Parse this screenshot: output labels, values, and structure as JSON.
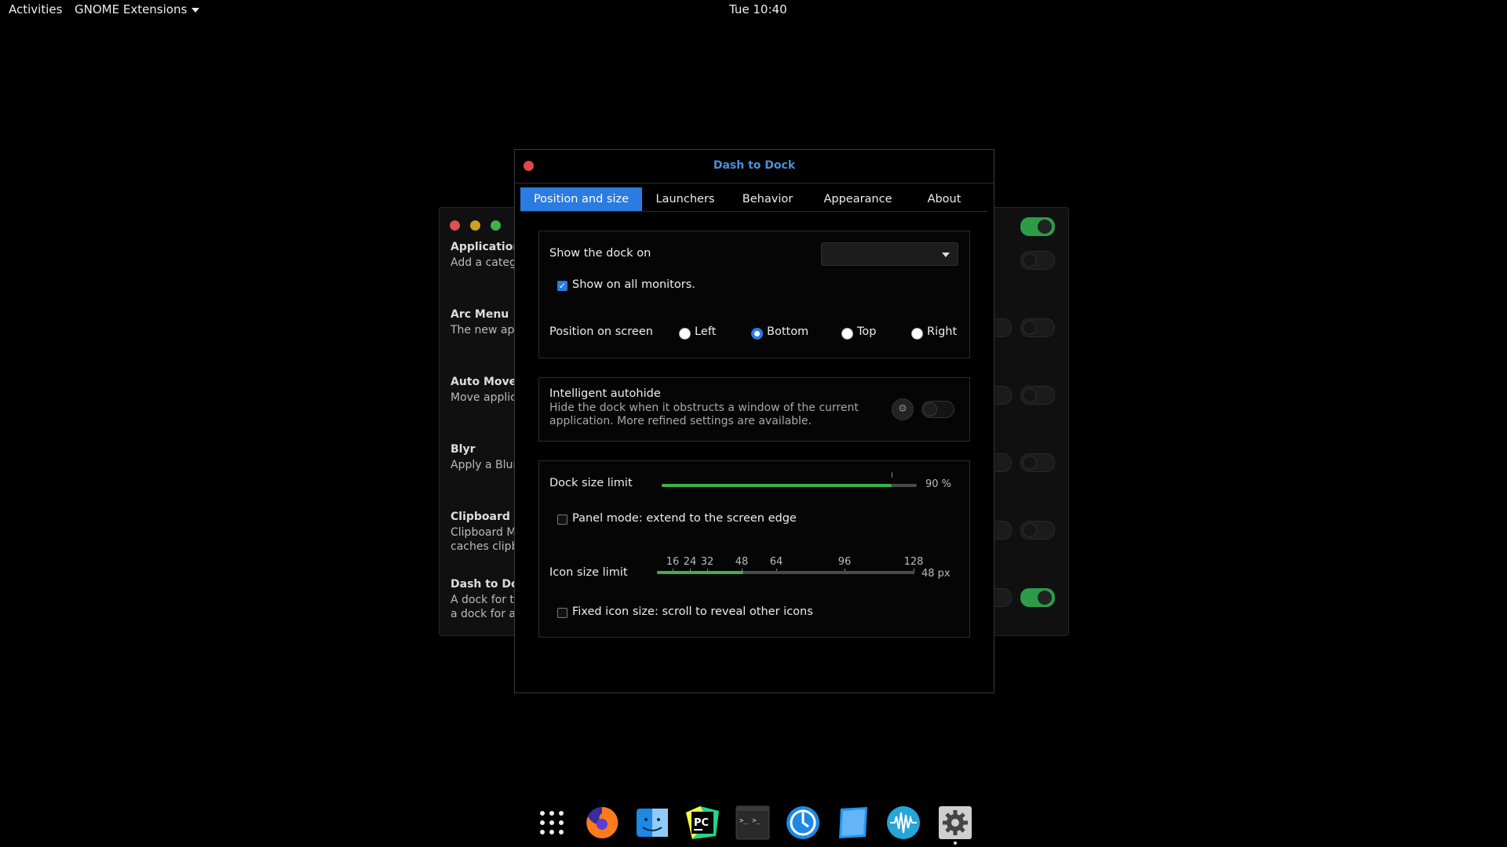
{
  "topbar": {
    "activities": "Activities",
    "app_menu": "GNOME Extensions",
    "clock": "Tue 10:40"
  },
  "background_window": {
    "extensions": [
      {
        "name": "Application",
        "desc": "Add a categ"
      },
      {
        "name": "Arc Menu",
        "desc": "The new app"
      },
      {
        "name": "Auto Move",
        "desc": "Move applic"
      },
      {
        "name": "Blyr",
        "desc": "Apply a Blur"
      },
      {
        "name": "Clipboard In",
        "desc": "Clipboard M",
        "desc2": "caches clipb"
      },
      {
        "name": "Dash to Doc",
        "desc": "A dock for th",
        "desc2": "a dock for ar"
      }
    ]
  },
  "dialog": {
    "title": "Dash to Dock",
    "tabs": [
      "Position and size",
      "Launchers",
      "Behavior",
      "Appearance",
      "About"
    ],
    "active_tab": 0,
    "position": {
      "show_dock_on": "Show the dock on",
      "monitor_value": "",
      "show_all_monitors": "Show on all monitors.",
      "position_label": "Position on screen",
      "options": [
        "Left",
        "Bottom",
        "Top",
        "Right"
      ],
      "selected": "Bottom"
    },
    "autohide": {
      "title": "Intelligent autohide",
      "desc_line1": "Hide the dock when it obstructs a window of the current",
      "desc_line2": "application. More refined settings are available.",
      "enabled": false
    },
    "size": {
      "dock_size_label": "Dock size limit",
      "dock_size_value": "90 %",
      "dock_size_fraction": 0.9,
      "panel_mode": "Panel mode: extend to the screen edge",
      "icon_size_label": "Icon size limit",
      "icon_size_value": "48 px",
      "icon_size_marks": [
        "16",
        "24",
        "32",
        "48",
        "64",
        "96",
        "128"
      ],
      "fixed_icon": "Fixed icon size: scroll to reveal other icons"
    }
  },
  "colors": {
    "accent": "#2b7be0",
    "slider": "#3bb34a",
    "title": "#4a90d9"
  },
  "dock_icons": [
    "apps-grid-icon",
    "firefox-icon",
    "finder-icon",
    "pycharm-icon",
    "terminal-icon",
    "clock-app-icon",
    "notes-icon",
    "audio-wave-icon",
    "settings-icon"
  ]
}
